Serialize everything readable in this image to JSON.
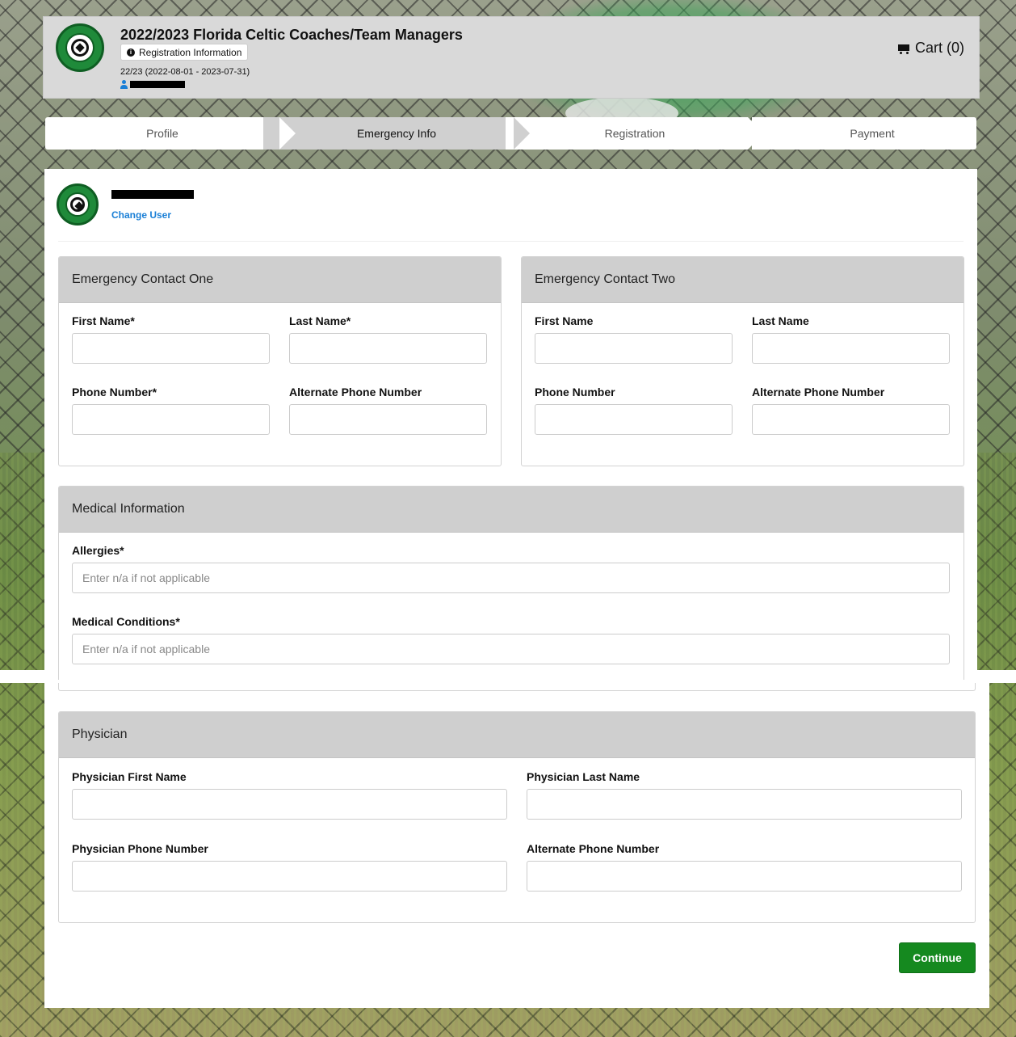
{
  "header": {
    "title": "2022/2023 Florida Celtic Coaches/Team Managers",
    "registration_info_label": "Registration Information",
    "season": "22/23 (2022-08-01 - 2023-07-31)",
    "cart_label": "Cart (0)"
  },
  "steps": [
    {
      "label": "Profile",
      "active": false
    },
    {
      "label": "Emergency Info",
      "active": true
    },
    {
      "label": "Registration",
      "active": false
    },
    {
      "label": "Payment",
      "active": false
    }
  ],
  "user": {
    "change_user_label": "Change User"
  },
  "emergency_contact_one": {
    "title": "Emergency Contact One",
    "first_name_label": "First Name*",
    "last_name_label": "Last Name*",
    "phone_label": "Phone Number*",
    "alt_phone_label": "Alternate Phone Number"
  },
  "emergency_contact_two": {
    "title": "Emergency Contact Two",
    "first_name_label": "First Name",
    "last_name_label": "Last Name",
    "phone_label": "Phone Number",
    "alt_phone_label": "Alternate Phone Number"
  },
  "medical": {
    "title": "Medical Information",
    "allergies_label": "Allergies*",
    "allergies_placeholder": "Enter n/a if not applicable",
    "conditions_label": "Medical Conditions*",
    "conditions_placeholder": "Enter n/a if not applicable"
  },
  "physician": {
    "title": "Physician",
    "first_name_label": "Physician First Name",
    "last_name_label": "Physician Last Name",
    "phone_label": "Physician Phone Number",
    "alt_phone_label": "Alternate Phone Number"
  },
  "actions": {
    "continue_label": "Continue"
  },
  "colors": {
    "accent_green": "#15891f",
    "link_blue": "#1a7fd6",
    "panel_header": "#cfcfcf"
  }
}
